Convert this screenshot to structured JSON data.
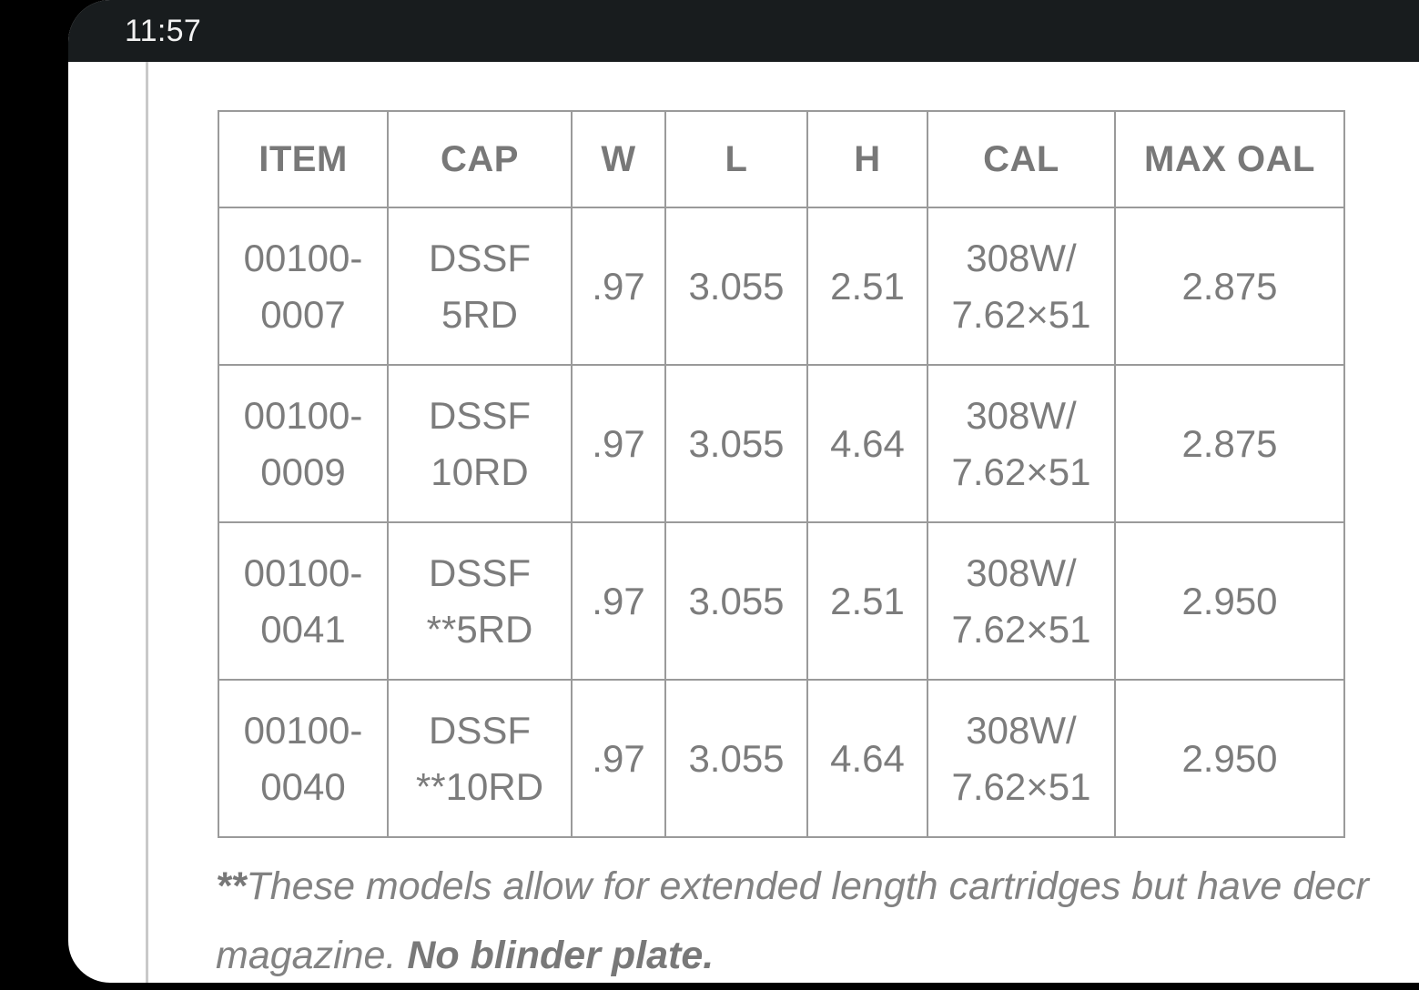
{
  "status_bar": {
    "time": "11:57",
    "background_color": "#181c1e",
    "text_color": "#f2f2f2"
  },
  "page": {
    "background_color": "#ffffff",
    "outer_background_color": "#000000",
    "text_color": "#7c7c7c",
    "border_color": "#9a9a9a"
  },
  "table": {
    "name": "magazine-specification-table",
    "headers": [
      "ITEM",
      "CAP",
      "W",
      "L",
      "H",
      "CAL",
      "MAX OAL"
    ],
    "rows": [
      {
        "item_line1": "00100-",
        "item_line2": "0007",
        "cap_line1": "DSSF",
        "cap_line2": "5RD",
        "w": ".97",
        "l": "3.055",
        "h": "2.51",
        "cal_line1": "308W/",
        "cal_line2": "7.62×51",
        "max_oal": "2.875"
      },
      {
        "item_line1": "00100-",
        "item_line2": "0009",
        "cap_line1": "DSSF",
        "cap_line2": "10RD",
        "w": ".97",
        "l": "3.055",
        "h": "4.64",
        "cal_line1": "308W/",
        "cal_line2": "7.62×51",
        "max_oal": "2.875"
      },
      {
        "item_line1": "00100-",
        "item_line2": "0041",
        "cap_line1": "DSSF",
        "cap_line2": "**5RD",
        "w": ".97",
        "l": "3.055",
        "h": "2.51",
        "cal_line1": "308W/",
        "cal_line2": "7.62×51",
        "max_oal": "2.950"
      },
      {
        "item_line1": "00100-",
        "item_line2": "0040",
        "cap_line1": "DSSF",
        "cap_line2": "**10RD",
        "w": ".97",
        "l": "3.055",
        "h": "4.64",
        "cal_line1": "308W/",
        "cal_line2": "7.62×51",
        "max_oal": "2.950"
      }
    ]
  },
  "footnote": {
    "marker": "**",
    "line1": "These models allow for extended length cartridges but have decr",
    "line2_prefix": "magazine. ",
    "line2_strong": "No blinder plate."
  }
}
